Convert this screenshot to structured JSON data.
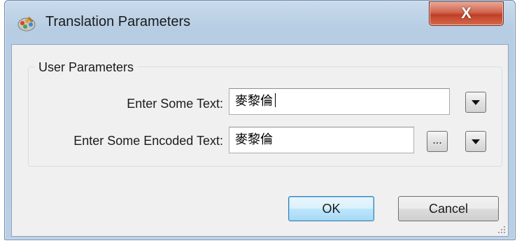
{
  "window": {
    "title": "Translation Parameters",
    "close_label": "X"
  },
  "group": {
    "label": "User Parameters"
  },
  "fields": [
    {
      "label": "Enter Some Text:",
      "value": "麥黎倫"
    },
    {
      "label": "Enter Some Encoded Text:",
      "value": "麥黎倫",
      "browse_label": "..."
    }
  ],
  "buttons": {
    "ok": "OK",
    "cancel": "Cancel"
  },
  "icons": {
    "app": "translation-app-icon",
    "dropdown": "triangle-down-icon",
    "grip": "resize-grip-icon"
  },
  "colors": {
    "title_bar": "#b9cfe5",
    "close_button": "#c03f26",
    "dialog_bg": "#f0f0f0",
    "default_button_border": "#3c7fb1"
  }
}
